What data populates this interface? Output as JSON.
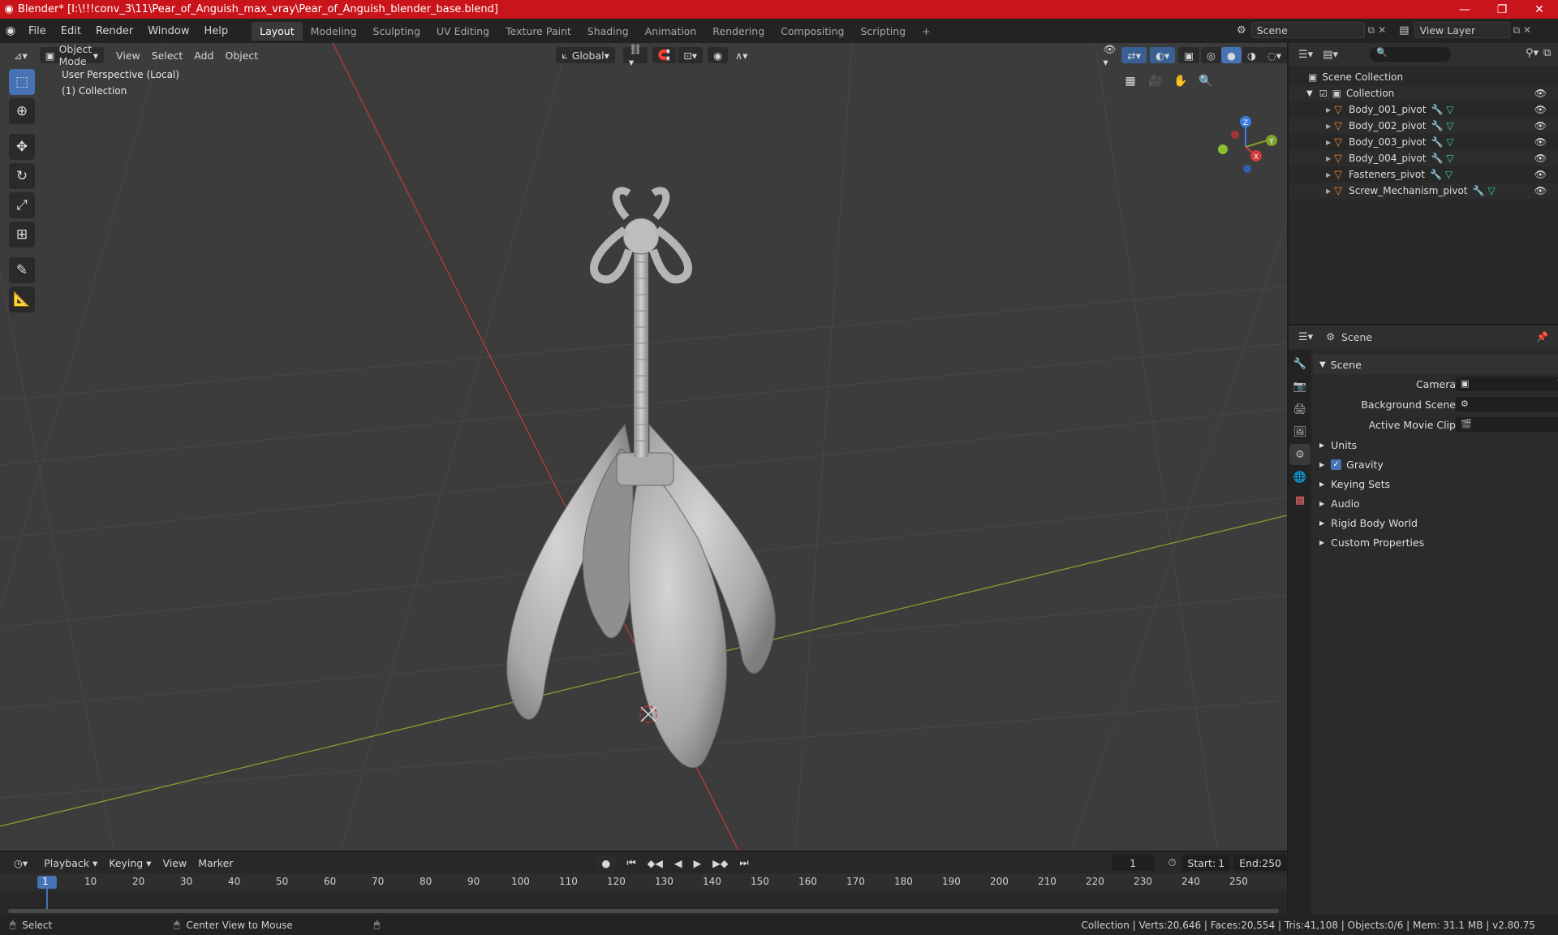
{
  "titlebar": {
    "title": "Blender* [I:\\!!!conv_3\\11\\Pear_of_Anguish_max_vray\\Pear_of_Anguish_blender_base.blend]"
  },
  "menu": [
    "File",
    "Edit",
    "Render",
    "Window",
    "Help"
  ],
  "workspaces": [
    "Layout",
    "Modeling",
    "Sculpting",
    "UV Editing",
    "Texture Paint",
    "Shading",
    "Animation",
    "Rendering",
    "Compositing",
    "Scripting"
  ],
  "scene_field": "Scene",
  "viewlayer_field": "View Layer",
  "viewport": {
    "mode": "Object Mode",
    "menus": [
      "View",
      "Select",
      "Add",
      "Object"
    ],
    "orientation": "Global",
    "overlay_title": "User Perspective (Local)",
    "overlay_collection": "(1) Collection",
    "gizmo": {
      "x": "X",
      "y": "Y",
      "z": "Z"
    }
  },
  "outliner": {
    "root": "Scene Collection",
    "collection": "Collection",
    "items": [
      "Body_001_pivot",
      "Body_002_pivot",
      "Body_003_pivot",
      "Body_004_pivot",
      "Fasteners_pivot",
      "Screw_Mechanism_pivot"
    ]
  },
  "properties": {
    "header": "Scene",
    "section": "Scene",
    "camera_label": "Camera",
    "background_label": "Background Scene",
    "movieclip_label": "Active Movie Clip",
    "panels": [
      "Units",
      "Gravity",
      "Keying Sets",
      "Audio",
      "Rigid Body World",
      "Custom Properties"
    ],
    "gravity_checked": true
  },
  "timeline": {
    "menus": [
      "Playback",
      "Keying",
      "View",
      "Marker"
    ],
    "current_frame": "1",
    "start_label": "Start:",
    "start": "1",
    "end_label": "End:",
    "end": "250",
    "ruler": [
      "1",
      "10",
      "20",
      "30",
      "40",
      "50",
      "60",
      "70",
      "80",
      "90",
      "100",
      "110",
      "120",
      "130",
      "140",
      "150",
      "160",
      "170",
      "180",
      "190",
      "200",
      "210",
      "220",
      "230",
      "240",
      "250"
    ]
  },
  "status": {
    "select": "Select",
    "center": "Center View to Mouse",
    "stats": "Collection | Verts:20,646 | Faces:20,554 | Tris:41,108 | Objects:0/6 | Mem: 31.1 MB | v2.80.75"
  },
  "colors": {
    "accent": "#4772b3",
    "titlebar": "#c8141a",
    "object_icon": "#ee8a30",
    "mesh_icon": "#3fd3a4",
    "modifier_icon": "#5ea5f0"
  }
}
